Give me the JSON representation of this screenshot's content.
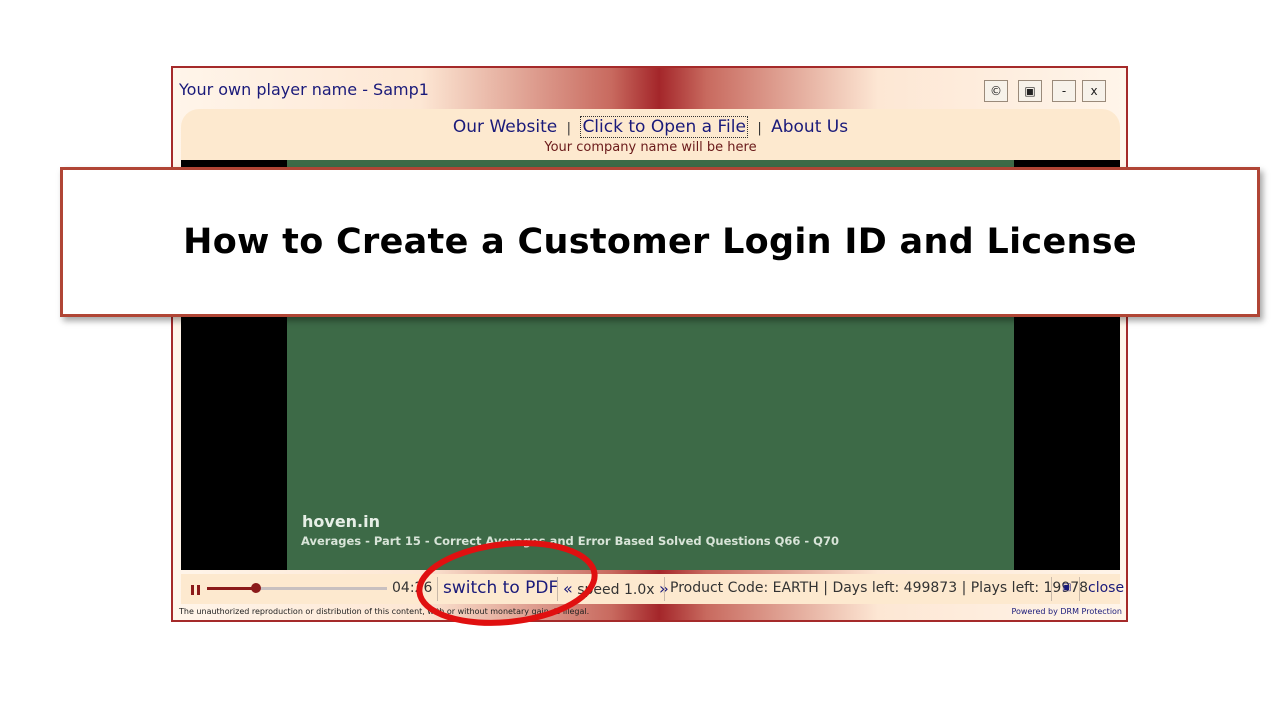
{
  "window": {
    "title": "Your own player name - Samp1",
    "buttons": {
      "copyright": "©",
      "maximize": "▣",
      "minimize": "-",
      "close": "x"
    }
  },
  "header": {
    "nav": {
      "website": "Our Website",
      "separator": "|",
      "open_file": "Click to Open a File",
      "about": "About Us"
    },
    "company": "Your company name will be here"
  },
  "video": {
    "site": "hoven.in",
    "caption": "Averages - Part 15 - Correct Averages and Error Based Solved Questions Q66 - Q70"
  },
  "controls": {
    "time": "04:26",
    "progress_fraction": 0.27,
    "switch_pdf": "switch to PDF",
    "speed_down": "«",
    "speed_label": "speed 1.0x",
    "speed_up": "»",
    "info": "Product Code: EARTH | Days left: 499873 | Plays left: 19978",
    "mini_icon": "▣",
    "close": "close"
  },
  "footer": {
    "notice": "The unauthorized reproduction or distribution of this content, with or without monetary gain, is illegal.",
    "powered": "Powered by DRM Protection"
  },
  "banner": {
    "text": "How to Create a Customer Login ID and License"
  },
  "colors": {
    "accent": "#a4262a",
    "panel": "#fde9cf",
    "link": "#1a1a7a",
    "slide": "#3d6a47",
    "highlight_circle": "#e01010"
  }
}
